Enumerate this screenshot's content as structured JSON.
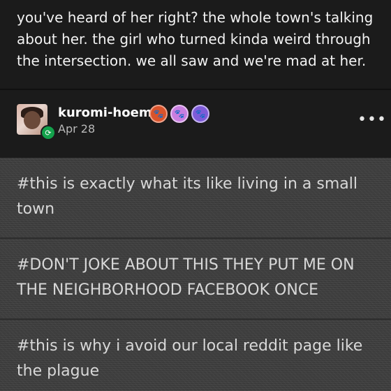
{
  "post": {
    "text": "you've heard of her right? the whole town's talking about her. the girl who turned kinda weird through the intersection. we all saw and we're mad at her."
  },
  "reblog": {
    "username": "kuromi-hoemie",
    "date": "Apr 28",
    "more_label": "•••",
    "badges": [
      "paw-badge-orange",
      "paw-badge-pink",
      "paw-badge-purple"
    ]
  },
  "tags": [
    "#this is exactly what its like living in a small town",
    "#DON'T JOKE ABOUT THIS THEY PUT ME ON THE NEIGHBORHOOD FACEBOOK ONCE",
    "#this is why i avoid our local reddit page like the plague"
  ],
  "colors": {
    "background": "#1b1b1b",
    "reblog_green": "#13a24b",
    "tag_background": "#3e3e3e"
  }
}
